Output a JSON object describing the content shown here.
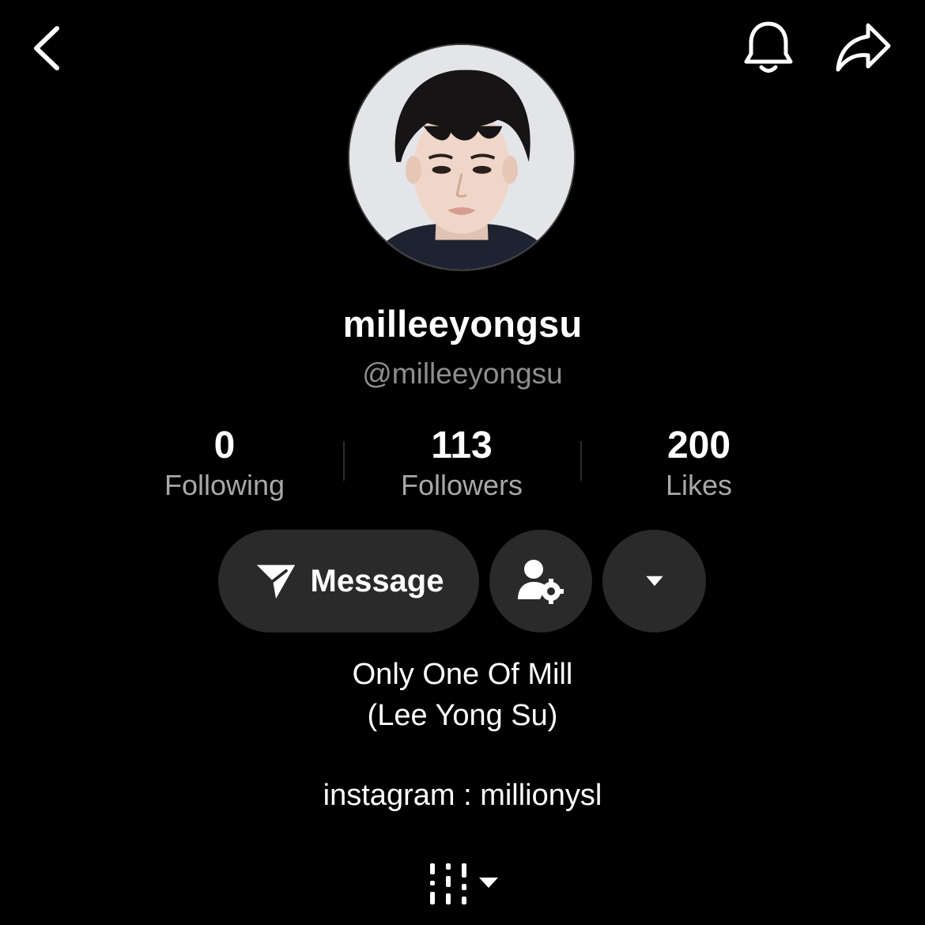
{
  "topbar": {
    "back_icon": "chevron-left-icon",
    "bell_icon": "bell-icon",
    "share_icon": "share-arrow-icon"
  },
  "profile": {
    "display_name": "milleeyongsu",
    "handle": "@milleeyongsu",
    "avatar": "avatar-photo"
  },
  "stats": [
    {
      "value": "0",
      "label": "Following"
    },
    {
      "value": "113",
      "label": "Followers"
    },
    {
      "value": "200",
      "label": "Likes"
    }
  ],
  "actions": {
    "message_label": "Message",
    "message_icon": "send-icon",
    "settings_icon": "user-settings-icon",
    "dropdown_icon": "caret-down-icon"
  },
  "bio": {
    "line1": "Only One Of Mill",
    "line2": "(Lee Yong Su)",
    "line3": "instagram : millionysl"
  },
  "bottom": {
    "menu_icon": "bars-dropdown-icon"
  },
  "colors": {
    "background": "#000000",
    "button": "#2a2a2a",
    "secondary_text": "#8e8e8e"
  }
}
